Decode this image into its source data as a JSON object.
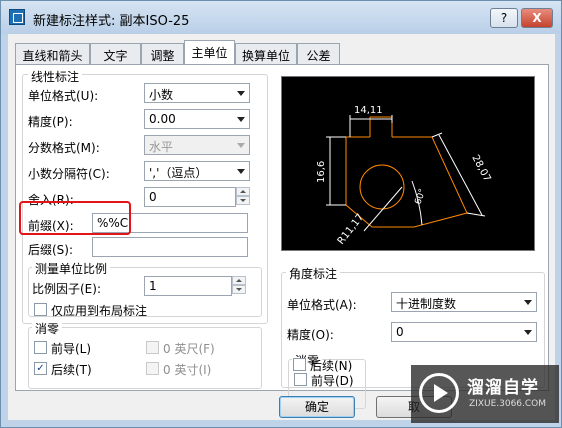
{
  "window": {
    "title": "新建标注样式: 副本ISO-25",
    "help_label": "?",
    "close_label": "X"
  },
  "tabs": [
    "直线和箭头",
    "文字",
    "调整",
    "主单位",
    "换算单位",
    "公差"
  ],
  "linear": {
    "group_title": "线性标注",
    "unit_format_label": "单位格式(U):",
    "unit_format_value": "小数",
    "precision_label": "精度(P):",
    "precision_value": "0.00",
    "fraction_label": "分数格式(M):",
    "fraction_value": "水平",
    "decimal_sep_label": "小数分隔符(C):",
    "decimal_sep_value": "','（逗点）",
    "roundoff_label": "舍入(R):",
    "roundoff_value": "0",
    "prefix_label": "前缀(X):",
    "prefix_value": "%%C",
    "suffix_label": "后缀(S):",
    "suffix_value": ""
  },
  "scale": {
    "group_title": "测量单位比例",
    "factor_label": "比例因子(E):",
    "factor_value": "1",
    "layout_only_label": "仅应用到布局标注"
  },
  "zero_left": {
    "group_title": "消零",
    "leading_label": "前导(L)",
    "trailing_label": "后续(T)",
    "feet_label": "0 英尺(F)",
    "inches_label": "0 英寸(I)",
    "leading_checked": false,
    "trailing_checked": true
  },
  "angular": {
    "group_title": "角度标注",
    "unit_format_label": "单位格式(A):",
    "unit_format_value": "十进制度数",
    "precision_label": "精度(O):",
    "precision_value": "0"
  },
  "zero_right": {
    "group_title": "消零",
    "leading_label": "前导(D)",
    "trailing_label": "后续(N)",
    "leading_checked": false,
    "trailing_checked": false
  },
  "preview": {
    "dim_top": "14,11",
    "dim_left": "16,6",
    "dim_right": "28,07",
    "dim_angle": "60°",
    "dim_radius": "R11,17"
  },
  "buttons": {
    "ok": "确定",
    "cancel": "取"
  },
  "watermark": {
    "brand": "溜溜自学",
    "url": "ZIXUE.3066.COM"
  },
  "colors": {
    "dim_line": "#ffffff",
    "geometry": "#ff8a00",
    "highlight": "#e3131a"
  }
}
